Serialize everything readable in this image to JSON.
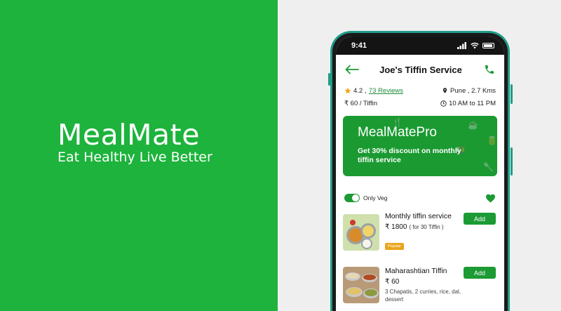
{
  "brand": {
    "name": "MealMate",
    "tagline": "Eat Healthy Live Better"
  },
  "status_bar": {
    "time": "9:41"
  },
  "header": {
    "title": "Joe's Tiffin Service"
  },
  "info": {
    "rating": "4.2",
    "separator": ",",
    "reviews": "73 Reviews",
    "location": "Pune , 2.7 Kms",
    "price": "₹ 60 / Tiffin",
    "hours": "10 AM to 11 PM"
  },
  "promo": {
    "brand": "MealMate",
    "pro": "Pro",
    "text": "Get 30% discount on monthly tiffin service"
  },
  "filter": {
    "only_veg_label": "Only Veg",
    "only_veg_on": true
  },
  "menu_items": [
    {
      "name": "Monthly tiffin service",
      "price": "₹ 1800",
      "price_note": "( for 30 Tiffin )",
      "badge": "Popular",
      "add_label": "Add"
    },
    {
      "name": "Maharashtian Tiffin",
      "price": "₹ 60",
      "description": "3 Chapatis, 2 curries, rice, dal, dessert",
      "add_label": "Add"
    }
  ],
  "colors": {
    "brand_green": "#1db33c",
    "button_green": "#1c9a34",
    "phone_frame": "#1e9c86",
    "badge_orange": "#e9a51c",
    "star": "#f2a516"
  }
}
